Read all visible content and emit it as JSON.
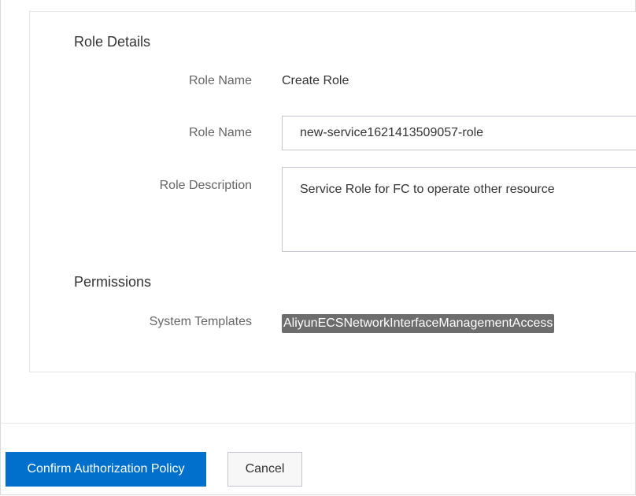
{
  "role_details": {
    "section_title": "Role Details",
    "role_name_label": "Role Name",
    "role_name_value": "Create Role",
    "role_name_input_label": "Role Name",
    "role_name_input_value": "new-service1621413509057-role",
    "role_description_label": "Role Description",
    "role_description_value": "Service Role for FC to operate other resource"
  },
  "permissions": {
    "section_title": "Permissions",
    "system_templates_label": "System Templates",
    "system_template_tag": "AliyunECSNetworkInterfaceManagementAccess"
  },
  "footer": {
    "confirm_label": "Confirm Authorization Policy",
    "cancel_label": "Cancel"
  },
  "colors": {
    "primary": "#0070cc",
    "tag_bg": "#6d6d6d"
  }
}
